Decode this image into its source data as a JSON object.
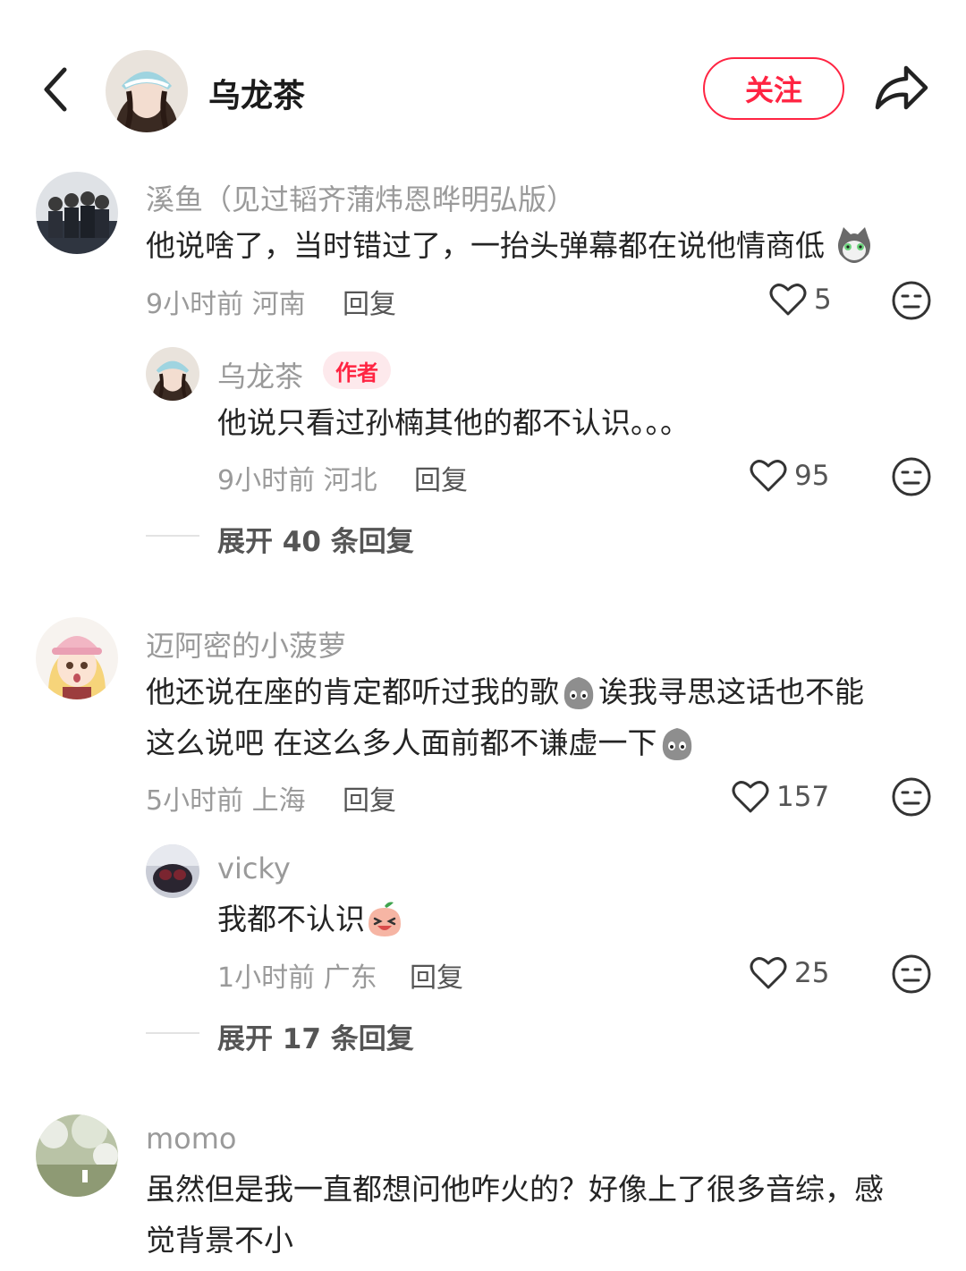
{
  "header": {
    "author_name": "乌龙茶",
    "follow_label": "关注"
  },
  "comments": [
    {
      "nickname": "溪鱼（见过韬齐蒲炜恩晔明弘版）",
      "text": "他说啥了，当时错过了，一抬头弹幕都在说他情商低",
      "time": "9小时前",
      "location": "河南",
      "reply_label": "回复",
      "likes": "5"
    },
    {
      "nickname": "乌龙茶",
      "badge": "作者",
      "text": "他说只看过孙楠其他的都不认识。。。",
      "time": "9小时前",
      "location": "河北",
      "reply_label": "回复",
      "likes": "95"
    },
    {
      "expand": "展开 40 条回复"
    },
    {
      "nickname": "迈阿密的小菠萝",
      "text_line1_a": "他还说在座的肯定都听过我的歌",
      "text_line1_b": "诶我寻思这话也不能",
      "text_line2": "这么说吧 在这么多人面前都不谦虚一下",
      "time": "5小时前",
      "location": "上海",
      "reply_label": "回复",
      "likes": "157"
    },
    {
      "nickname": "vicky",
      "text": "我都不认识",
      "time": "1小时前",
      "location": "广东",
      "reply_label": "回复",
      "likes": "25"
    },
    {
      "expand": "展开 17 条回复"
    },
    {
      "nickname": "momo",
      "text_line1": "虽然但是我一直都想问他咋火的？好像上了很多音综，感",
      "text_line2": "觉背景不小"
    }
  ],
  "colors": {
    "accent": "#ff2442",
    "nickname": "#9a9a9a",
    "text": "#242424"
  },
  "icons": [
    "back-arrow-icon",
    "share-icon",
    "heart-icon",
    "dislike-face-icon"
  ]
}
